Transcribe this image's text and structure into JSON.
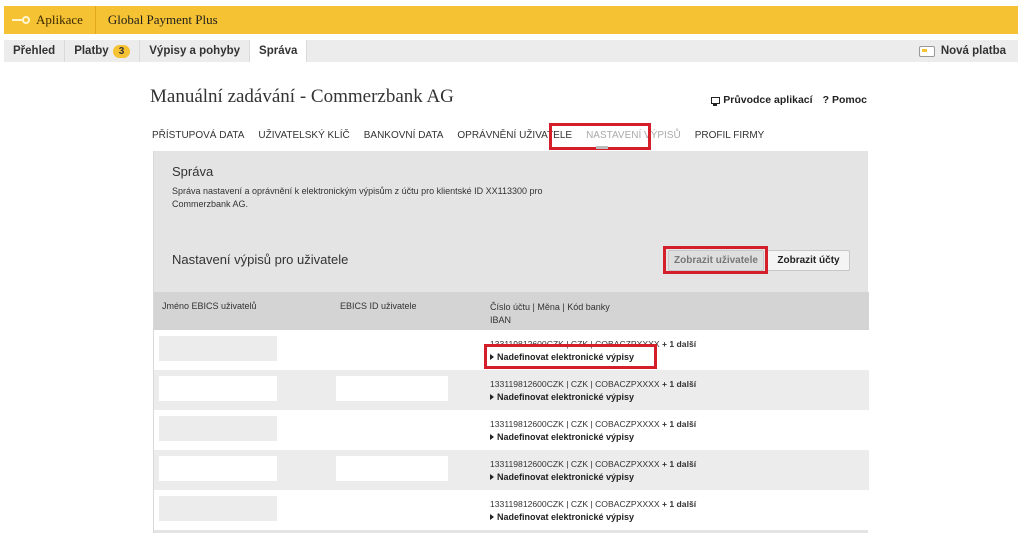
{
  "topbar": {
    "app_label": "Aplikace",
    "product_label": "Global Payment Plus"
  },
  "mainnav": {
    "items": [
      {
        "label": "Přehled"
      },
      {
        "label": "Platby",
        "badge": "3"
      },
      {
        "label": "Výpisy a pohyby"
      },
      {
        "label": "Správa",
        "active": true
      }
    ],
    "new_payment_label": "Nová platba"
  },
  "page": {
    "title": "Manuální zadávání - Commerzbank AG",
    "guide_link": "Průvodce aplikací",
    "help_link": "Pomoc"
  },
  "subtabs": [
    {
      "label": "PŘÍSTUPOVÁ DATA"
    },
    {
      "label": "UŽIVATELSKÝ KLÍČ"
    },
    {
      "label": "BANKOVNÍ DATA"
    },
    {
      "label": "OPRÁVNĚNÍ UŽIVATELE"
    },
    {
      "label": "NASTAVENÍ VÝPISŮ",
      "active": true
    },
    {
      "label": "PROFIL FIRMY"
    }
  ],
  "panel": {
    "section_title": "Správa",
    "section_description": "Správa nastavení a oprávnění k elektronickým výpisům z účtu pro klientské ID XX113300 pro Commerzbank AG.",
    "subsection_title": "Nastavení výpisů pro uživatele",
    "show_users_button": "Zobrazit uživatele",
    "show_accounts_button": "Zobrazit účty"
  },
  "table": {
    "headers": {
      "user_name": "Jméno EBICS uživatelů",
      "user_id": "EBICS ID uživatele",
      "account": "Číslo účtu | Měna | Kód banky",
      "iban": "IBAN"
    },
    "rows": [
      {
        "account": "133119812600CZK | CZK | COBACZPXXXX",
        "more": "+ 1 další",
        "define": "Nadefinovat elektronické výpisy"
      },
      {
        "account": "133119812600CZK | CZK | COBACZPXXXX",
        "more": "+ 1 další",
        "define": "Nadefinovat elektronické výpisy"
      },
      {
        "account": "133119812600CZK | CZK | COBACZPXXXX",
        "more": "+ 1 další",
        "define": "Nadefinovat elektronické výpisy"
      },
      {
        "account": "133119812600CZK | CZK | COBACZPXXXX",
        "more": "+ 1 další",
        "define": "Nadefinovat elektronické výpisy"
      },
      {
        "account": "133119812600CZK | CZK | COBACZPXXXX",
        "more": "+ 1 další",
        "define": "Nadefinovat elektronické výpisy"
      }
    ]
  },
  "colors": {
    "accent_yellow": "#f5c233",
    "highlight_red": "#d41f2b",
    "panel_gray": "#e4e4e4"
  },
  "icons": {
    "app": "key-icon",
    "new_payment": "card-icon",
    "guide": "monitor-icon",
    "help": "question-icon",
    "define": "triangle-right-icon"
  }
}
